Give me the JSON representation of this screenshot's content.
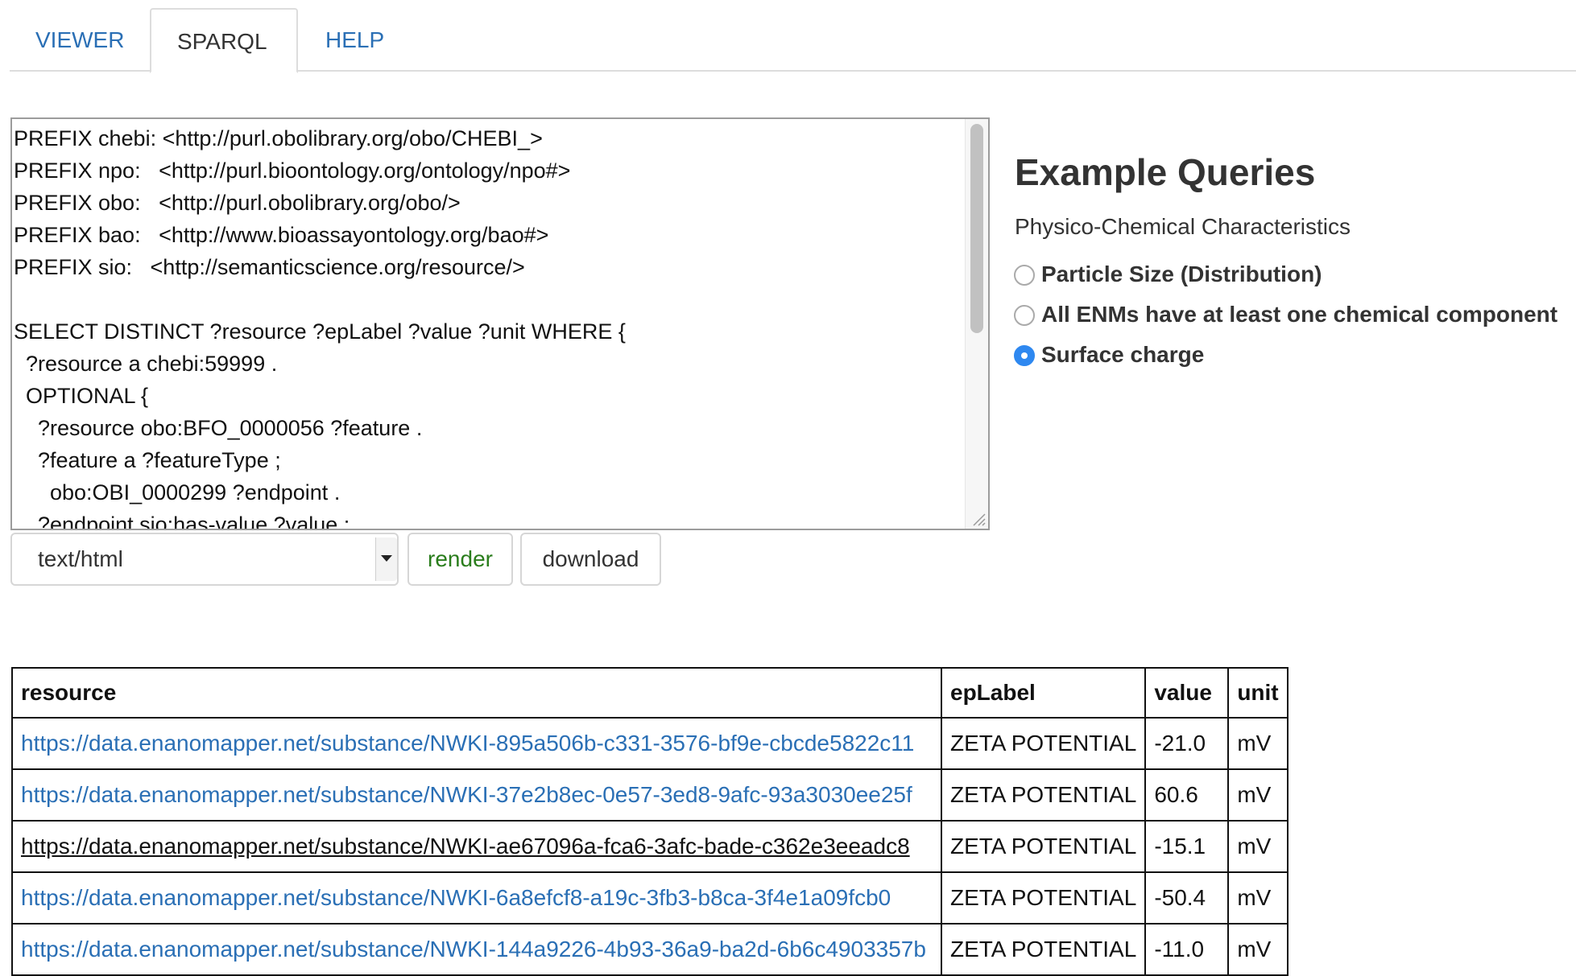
{
  "tabs": [
    {
      "label": "VIEWER"
    },
    {
      "label": "SPARQL"
    },
    {
      "label": "HELP"
    }
  ],
  "active_tab": "SPARQL",
  "editor": {
    "query": "PREFIX chebi: <http://purl.obolibrary.org/obo/CHEBI_>\nPREFIX npo:   <http://purl.bioontology.org/ontology/npo#>\nPREFIX obo:   <http://purl.obolibrary.org/obo/>\nPREFIX bao:   <http://www.bioassayontology.org/bao#>\nPREFIX sio:   <http://semanticscience.org/resource/>\n\nSELECT DISTINCT ?resource ?epLabel ?value ?unit WHERE {\n  ?resource a chebi:59999 .\n  OPTIONAL {\n    ?resource obo:BFO_0000056 ?feature .\n    ?feature a ?featureType ;\n      obo:OBI_0000299 ?endpoint .\n    ?endpoint sio:has-value ?value ;"
  },
  "controls": {
    "format_value": "text/html",
    "render_label": "render",
    "download_label": "download"
  },
  "examples": {
    "title": "Example Queries",
    "subtitle": "Physico-Chemical Characteristics",
    "options": [
      {
        "label": "Particle Size (Distribution)",
        "checked": false
      },
      {
        "label": "All ENMs have at least one chemical component",
        "checked": false
      },
      {
        "label": "Surface charge",
        "checked": true
      }
    ]
  },
  "results": {
    "headers": [
      "resource",
      "epLabel",
      "value",
      "unit"
    ],
    "rows": [
      {
        "resource": "https://data.enanomapper.net/substance/NWKI-895a506b-c331-3576-bf9e-cbcde5822c11",
        "epLabel": "ZETA POTENTIAL",
        "value": "-21.0",
        "unit": "mV"
      },
      {
        "resource": "https://data.enanomapper.net/substance/NWKI-37e2b8ec-0e57-3ed8-9afc-93a3030ee25f",
        "epLabel": "ZETA POTENTIAL",
        "value": "60.6",
        "unit": "mV"
      },
      {
        "resource": "https://data.enanomapper.net/substance/NWKI-ae67096a-fca6-3afc-bade-c362e3eeadc8",
        "epLabel": "ZETA POTENTIAL",
        "value": "-15.1",
        "unit": "mV"
      },
      {
        "resource": "https://data.enanomapper.net/substance/NWKI-6a8efcf8-a19c-3fb3-b8ca-3f4e1a09fcb0",
        "epLabel": "ZETA POTENTIAL",
        "value": "-50.4",
        "unit": "mV"
      },
      {
        "resource": "https://data.enanomapper.net/substance/NWKI-144a9226-4b93-36a9-ba2d-6b6c4903357b",
        "epLabel": "ZETA POTENTIAL",
        "value": "-11.0",
        "unit": "mV"
      }
    ]
  },
  "colors": {
    "link": "#2a6fb5",
    "render_button_text": "#2a7d1c",
    "radio_checked": "#2e88f0"
  }
}
